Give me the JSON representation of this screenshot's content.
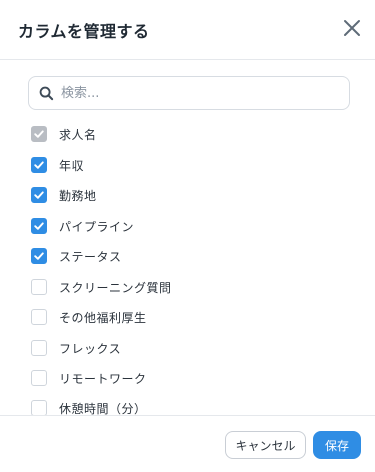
{
  "dialog": {
    "title": "カラムを管理する",
    "close_icon": "close-icon"
  },
  "search": {
    "placeholder": "検索...",
    "value": "",
    "icon": "search-icon"
  },
  "columns": [
    {
      "label": "求人名",
      "checked": true,
      "disabled": true
    },
    {
      "label": "年収",
      "checked": true,
      "disabled": false
    },
    {
      "label": "勤務地",
      "checked": true,
      "disabled": false
    },
    {
      "label": "パイプライン",
      "checked": true,
      "disabled": false
    },
    {
      "label": "ステータス",
      "checked": true,
      "disabled": false
    },
    {
      "label": "スクリーニング質問",
      "checked": false,
      "disabled": false
    },
    {
      "label": "その他福利厚生",
      "checked": false,
      "disabled": false
    },
    {
      "label": "フレックス",
      "checked": false,
      "disabled": false
    },
    {
      "label": "リモートワーク",
      "checked": false,
      "disabled": false
    },
    {
      "label": "休憩時間（分）",
      "checked": false,
      "disabled": false
    }
  ],
  "footer": {
    "cancel_label": "キャンセル",
    "save_label": "保存"
  },
  "colors": {
    "accent": "#2f8de4",
    "disabled_check": "#b9bdc3"
  }
}
